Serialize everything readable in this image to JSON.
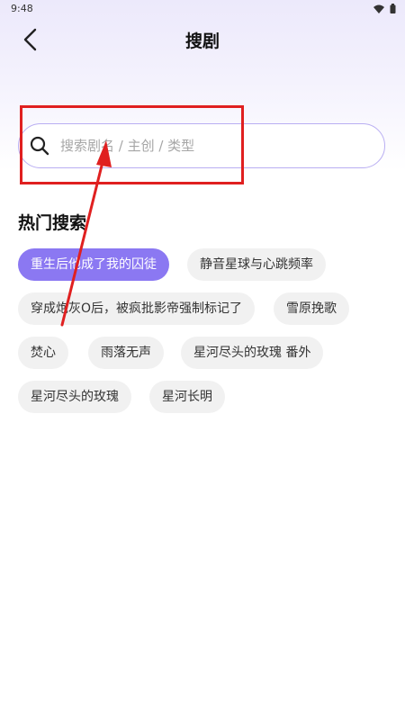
{
  "status_bar": {
    "time": "9:48"
  },
  "header": {
    "title": "搜剧"
  },
  "search": {
    "placeholder": "搜索剧名 / 主创 / 类型",
    "value": ""
  },
  "hot_search": {
    "title": "热门搜索",
    "tags": [
      "重生后他成了我的囚徒",
      "静音星球与心跳频率",
      "穿成炮灰O后，被疯批影帝强制标记了",
      "雪原挽歌",
      "焚心",
      "雨落无声",
      "星河尽头的玫瑰 番外",
      "星河尽头的玫瑰",
      "星河长明"
    ]
  },
  "colors": {
    "accent": "#8b78f2",
    "search_border": "#b9aef2",
    "tag_bg": "#f1f1f1",
    "annotation": "#e02020"
  }
}
